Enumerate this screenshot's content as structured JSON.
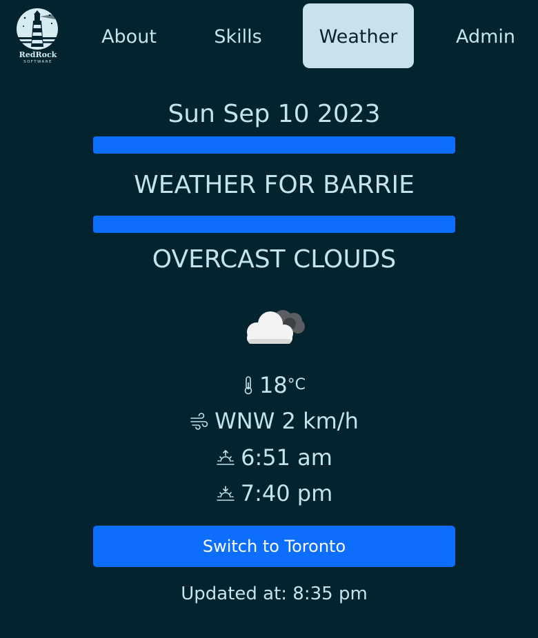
{
  "nav": {
    "logo_text": "RedRock",
    "logo_sub": "SOFTWARE",
    "items": [
      {
        "label": "About"
      },
      {
        "label": "Skills"
      },
      {
        "label": "Weather"
      },
      {
        "label": "Admin"
      }
    ],
    "active": "Weather"
  },
  "weather": {
    "date": "Sun Sep 10 2023",
    "city_heading": "WEATHER FOR BARRIE",
    "conditions": "OVERCAST CLOUDS",
    "condition_icon": "overcast-clouds-icon",
    "temperature": "18",
    "temperature_unit": "°C",
    "wind": "WNW 2 km/h",
    "sunrise": "6:51 am",
    "sunset": "7:40 pm",
    "switch_label": "Switch to Toronto",
    "updated": "Updated at: 8:35 pm"
  },
  "colors": {
    "background": "#03232f",
    "text": "#c8e2ec",
    "accent": "#0d6efd"
  }
}
